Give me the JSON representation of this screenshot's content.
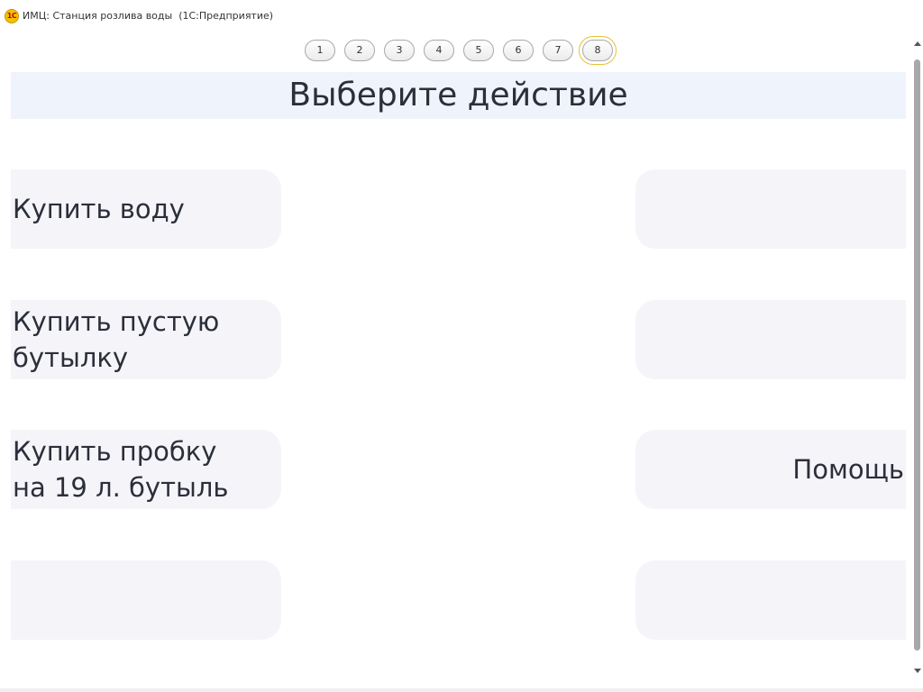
{
  "window": {
    "logo_text": "1С",
    "title": "ИМЦ: Станция розлива воды  (1С:Предприятие)"
  },
  "pager": {
    "pages": [
      "1",
      "2",
      "3",
      "4",
      "5",
      "6",
      "7",
      "8"
    ],
    "active": "8"
  },
  "header": {
    "title": "Выберите действие"
  },
  "actions": {
    "left": [
      {
        "line1": "Купить воду",
        "line2": ""
      },
      {
        "line1": "Купить пустую",
        "line2": "бутылку"
      },
      {
        "line1": "Купить пробку",
        "line2": "на 19 л. бутыль"
      },
      {
        "line1": "",
        "line2": ""
      }
    ],
    "right": [
      {
        "label": ""
      },
      {
        "label": ""
      },
      {
        "label": "Помощь"
      },
      {
        "label": ""
      }
    ]
  },
  "colors": {
    "header_band": "#eff3fc",
    "tile": "#f5f5f9",
    "text": "#2b2f3a",
    "active_page_outline": "#e5c232"
  }
}
